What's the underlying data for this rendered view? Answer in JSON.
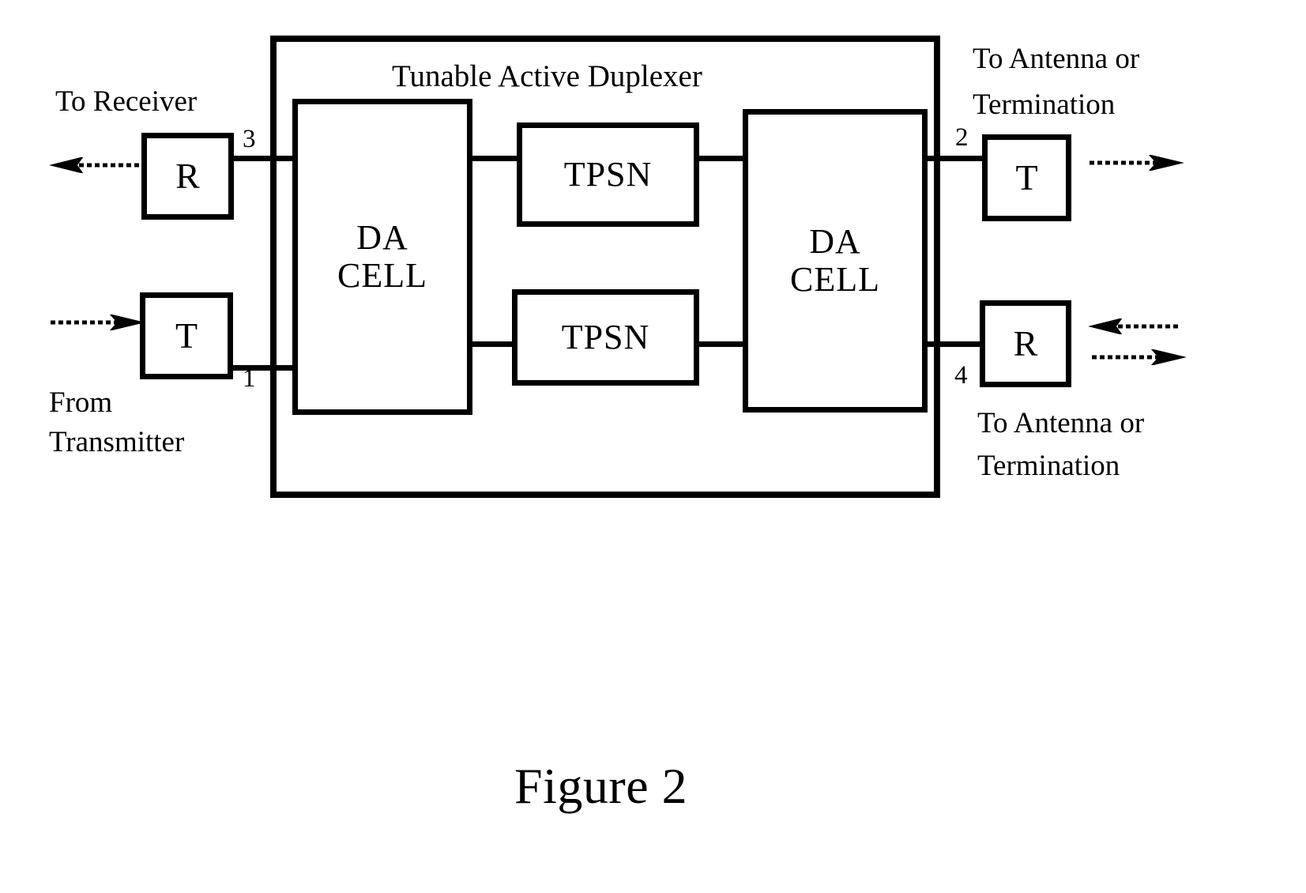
{
  "figure": {
    "caption": "Figure 2",
    "container_title": "Tunable Active Duplexer"
  },
  "diagram": {
    "type": "block-diagram",
    "outer_block": {
      "name": "Tunable Active Duplexer",
      "label": "Tunable Active Duplexer"
    },
    "internal_blocks": [
      {
        "id": "da-cell-left",
        "label_line1": "DA",
        "label_line2": "CELL"
      },
      {
        "id": "tpsn-top",
        "label": "TPSN"
      },
      {
        "id": "tpsn-bottom",
        "label": "TPSN"
      },
      {
        "id": "da-cell-right",
        "label_line1": "DA",
        "label_line2": "CELL"
      }
    ],
    "external_blocks": [
      {
        "id": "receiver-top-left",
        "label": "R",
        "port": "3",
        "caption": "To Receiver",
        "caption_lines": [
          "To Receiver"
        ]
      },
      {
        "id": "transmitter-bottom-left",
        "label": "T",
        "port": "1",
        "caption": "From Transmitter",
        "caption_lines": [
          "From",
          "Transmitter"
        ]
      },
      {
        "id": "transmitter-top-right",
        "label": "T",
        "port": "2",
        "caption": "To Antenna or Termination",
        "caption_lines": [
          "To Antenna or",
          "Termination"
        ]
      },
      {
        "id": "receiver-bottom-right",
        "label": "R",
        "port": "4",
        "caption": "To Antenna or Termination",
        "caption_lines": [
          "To Antenna or",
          "Termination"
        ]
      }
    ],
    "labels": {
      "to_receiver": "To Receiver",
      "from_line1": "From",
      "from_line2": "Transmitter",
      "antenna_top_line1": "To Antenna or",
      "antenna_top_line2": "Termination",
      "antenna_bottom_line1": "To Antenna or",
      "antenna_bottom_line2": "Termination",
      "da": "DA",
      "cell": "CELL",
      "tpsn": "TPSN",
      "r": "R",
      "t": "T"
    },
    "ports": {
      "p1": "1",
      "p2": "2",
      "p3": "3",
      "p4": "4"
    },
    "signal_arrows": [
      {
        "id": "arrow-to-receiver",
        "direction": "left",
        "style": "hatched"
      },
      {
        "id": "arrow-from-transmitter",
        "direction": "right",
        "style": "hatched"
      },
      {
        "id": "arrow-antenna-out-top",
        "direction": "right",
        "style": "hatched"
      },
      {
        "id": "arrow-antenna-in-bottom",
        "direction": "left",
        "style": "hatched"
      },
      {
        "id": "arrow-antenna-out-bottom",
        "direction": "right",
        "style": "hatched"
      }
    ],
    "colors": {
      "line": "#000000",
      "background": "#ffffff"
    }
  }
}
